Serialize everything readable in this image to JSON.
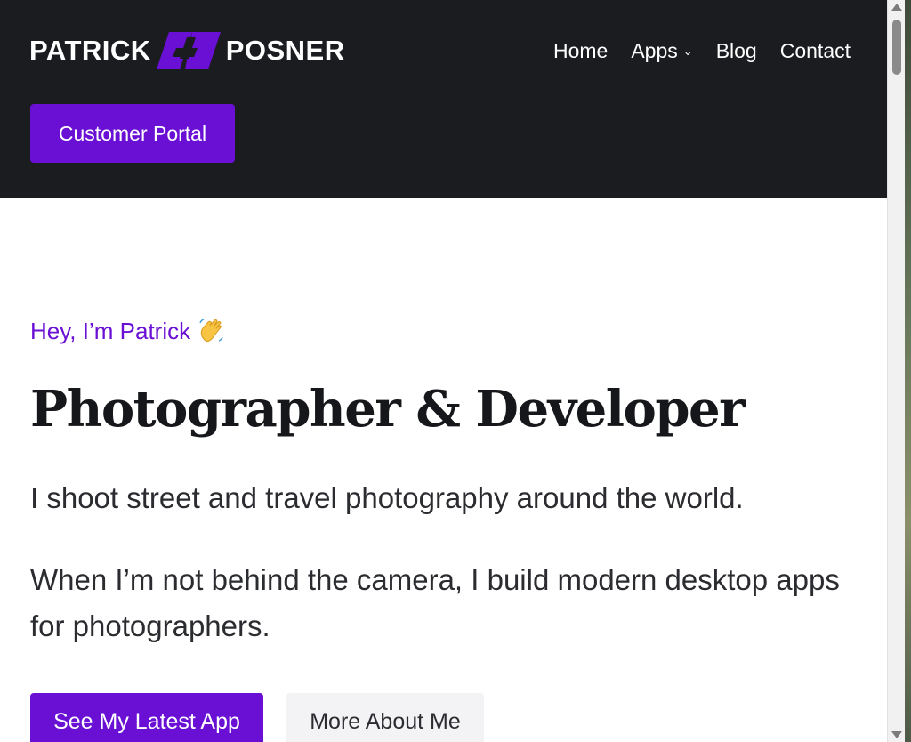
{
  "header": {
    "logo": {
      "left_text": "PATRICK",
      "right_text": "POSNER",
      "mark_icon": "pp-logo-mark-icon"
    },
    "nav": [
      {
        "label": "Home",
        "has_dropdown": false
      },
      {
        "label": "Apps",
        "has_dropdown": true
      },
      {
        "label": "Blog",
        "has_dropdown": false
      },
      {
        "label": "Contact",
        "has_dropdown": false
      }
    ],
    "dropdown_icon": "chevron-down-icon",
    "portal_button": "Customer Portal"
  },
  "hero": {
    "greeting": "Hey, I’m Patrick",
    "greeting_icon": "waving-hand-icon",
    "title": "Photographer & Developer",
    "paragraph_1": "I shoot street and travel photography around the world.",
    "paragraph_2": "When I’m not behind the camera, I build modern desktop apps for photographers.",
    "primary_button": "See My Latest App",
    "secondary_button": "More About Me"
  },
  "colors": {
    "header_bg": "#1b1c20",
    "accent": "#6a0fd4",
    "text_dark": "#16171a",
    "secondary_button_bg": "#f3f3f5"
  }
}
